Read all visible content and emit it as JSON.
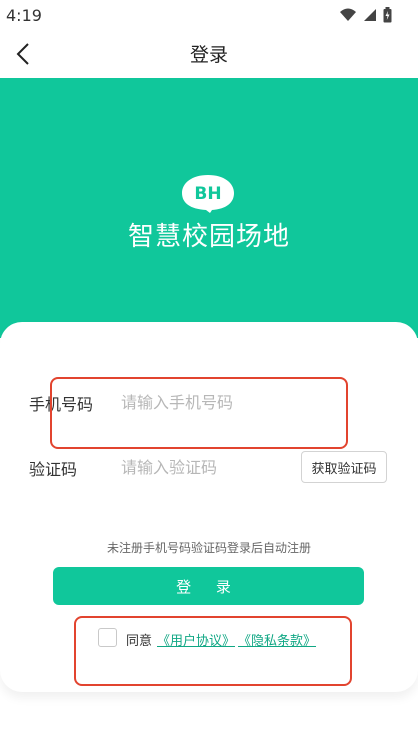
{
  "status_bar": {
    "time": "4:19"
  },
  "nav": {
    "title": "登录"
  },
  "hero": {
    "logo_text": "BH",
    "app_name": "智慧校园场地"
  },
  "form": {
    "phone_label": "手机号码",
    "phone_placeholder": "请输入手机号码",
    "code_label": "验证码",
    "code_placeholder": "请输入验证码",
    "get_code_button": "获取验证码",
    "hint": "未注册手机号码验证码登录后自动注册",
    "login_button": "登 录"
  },
  "agreement": {
    "prefix": "同意",
    "user_agreement": "《用户协议》",
    "privacy_policy": "《隐私条款》"
  },
  "colors": {
    "brand_green": "#10c79b",
    "highlight_red": "#e2442f"
  }
}
